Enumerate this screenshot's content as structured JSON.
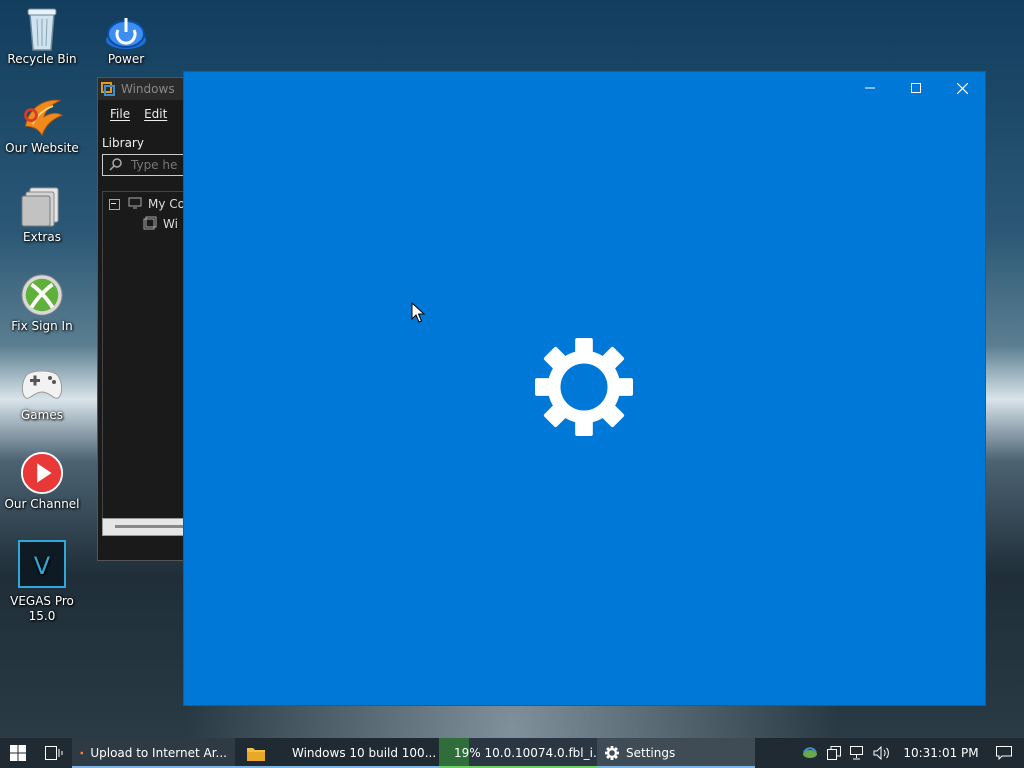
{
  "desktop": {
    "icons": [
      {
        "label": "Recycle Bin",
        "icon": "recycle-bin-icon"
      },
      {
        "label": "Power",
        "icon": "power-icon"
      },
      {
        "label": "Our Website",
        "icon": "website-icon"
      },
      {
        "label": "Extras",
        "icon": "folder-icon"
      },
      {
        "label": "Fix Sign In",
        "icon": "xbox-icon"
      },
      {
        "label": "Games",
        "icon": "gamepad-icon"
      },
      {
        "label": "Our Channel",
        "icon": "play-icon"
      },
      {
        "label": "VEGAS Pro 15.0",
        "icon": "vegas-icon"
      }
    ]
  },
  "bg_window": {
    "title": "Windows",
    "menu": [
      "File",
      "Edit"
    ],
    "library_label": "Library",
    "search_placeholder": "Type he",
    "tree": [
      "My Co",
      "Wi"
    ]
  },
  "settings_window": {
    "minimize": "—",
    "maximize": "☐",
    "close": "✕",
    "colors": {
      "background": "#0078d7",
      "gear": "#ffffff"
    }
  },
  "taskbar": {
    "tasks": [
      {
        "label": "Upload to Internet Ar...",
        "icon": "chrome-icon"
      },
      {
        "label": "",
        "icon": "file-explorer-icon"
      },
      {
        "label": "Windows 10 build 100...",
        "icon": "vmware-icon"
      },
      {
        "label": "19% 10.0.10074.0.fbl_i...",
        "icon": "download-progress-icon",
        "progress": 0.19
      },
      {
        "label": "Settings",
        "icon": "gear-icon"
      }
    ],
    "clock": "10:31:01 PM"
  }
}
